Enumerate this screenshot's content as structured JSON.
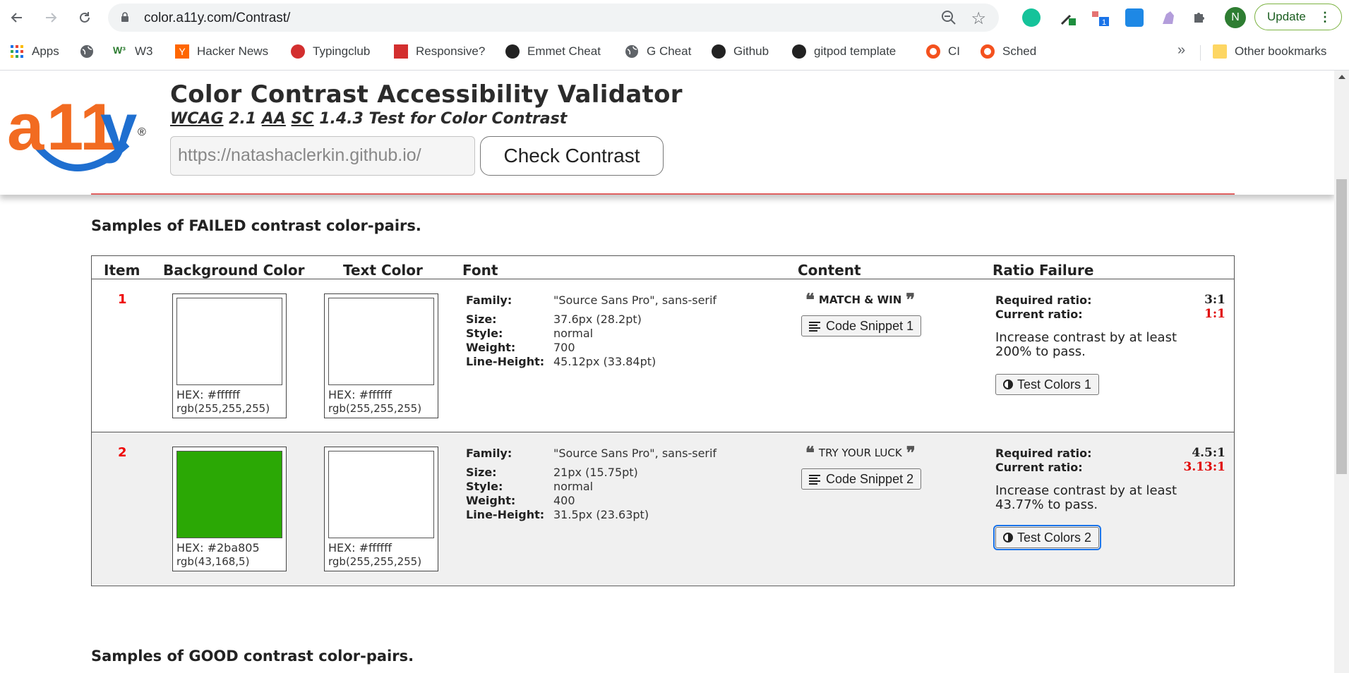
{
  "browser": {
    "url": "color.a11y.com/Contrast/",
    "avatar_letter": "N",
    "update_label": "Update",
    "bookmarks": [
      {
        "label": "Apps",
        "icon": "apps-grid-icon"
      },
      {
        "label": "",
        "icon": "globe-icon"
      },
      {
        "label": "W3",
        "icon": "w3schools-icon"
      },
      {
        "label": "Hacker News",
        "icon": "hacker-news-icon"
      },
      {
        "label": "Typingclub",
        "icon": "typingclub-icon"
      },
      {
        "label": "Responsive?",
        "icon": "responsive-icon"
      },
      {
        "label": "Emmet Cheat",
        "icon": "emmet-icon"
      },
      {
        "label": "G Cheat",
        "icon": "globe-icon"
      },
      {
        "label": "Github",
        "icon": "github-icon"
      },
      {
        "label": "gitpod template",
        "icon": "github-icon"
      },
      {
        "label": "CI",
        "icon": "ring-icon"
      },
      {
        "label": "Sched",
        "icon": "ring-icon"
      }
    ],
    "other_bookmarks": "Other bookmarks",
    "more_bookmarks": "»"
  },
  "header": {
    "logo_text": "a11y",
    "title": "Color Contrast Accessibility Validator",
    "subtitle_parts": [
      "WCAG",
      " 2.1 ",
      "AA",
      " ",
      "SC",
      " 1.4.3 Test for Color Contrast"
    ],
    "url_value": "https://natashaclerkin.github.io/",
    "check_button": "Check Contrast"
  },
  "failed": {
    "heading": "Samples of FAILED contrast color-pairs.",
    "columns": [
      "Item",
      "Background Color",
      "Text Color",
      "Font",
      "Content",
      "Ratio Failure"
    ],
    "rows": [
      {
        "item": "1",
        "bg_color": "#ffffff",
        "bg_hex": "HEX: #ffffff",
        "bg_rgb": "rgb(255,255,255)",
        "fg_color": "#ffffff",
        "fg_hex": "HEX: #ffffff",
        "fg_rgb": "rgb(255,255,255)",
        "font_labels": [
          "Family:",
          "Size:",
          "Style:",
          "Weight:",
          "Line-Height:"
        ],
        "font_values": [
          "\"Source Sans Pro\", sans-serif",
          "37.6px (28.2pt)",
          "normal",
          "700",
          "45.12px (33.84pt)"
        ],
        "content": "MATCH & WIN",
        "content_bold": true,
        "snippet": "Code Snippet 1",
        "required_label": "Required ratio:",
        "required": "3:1",
        "current_label": "Current ratio:",
        "current": "1:1",
        "advice": "Increase contrast by at least 200% to pass.",
        "test_button": "Test Colors 1"
      },
      {
        "item": "2",
        "bg_color": "#2ba805",
        "bg_hex": "HEX: #2ba805",
        "bg_rgb": "rgb(43,168,5)",
        "fg_color": "#ffffff",
        "fg_hex": "HEX: #ffffff",
        "fg_rgb": "rgb(255,255,255)",
        "font_labels": [
          "Family:",
          "Size:",
          "Style:",
          "Weight:",
          "Line-Height:"
        ],
        "font_values": [
          "\"Source Sans Pro\", sans-serif",
          "21px (15.75pt)",
          "normal",
          "400",
          "31.5px (23.63pt)"
        ],
        "content": "TRY YOUR LUCK",
        "content_bold": false,
        "snippet": "Code Snippet 2",
        "required_label": "Required ratio:",
        "required": "4.5:1",
        "current_label": "Current ratio:",
        "current": "3.13:1",
        "advice": "Increase contrast by at least 43.77% to pass.",
        "test_button": "Test Colors 2"
      }
    ]
  },
  "good": {
    "heading": "Samples of GOOD contrast color-pairs."
  },
  "colors": {
    "fail_red": "#e00000",
    "logo_orange": "#f26b21",
    "logo_blue": "#1f6fd0"
  }
}
